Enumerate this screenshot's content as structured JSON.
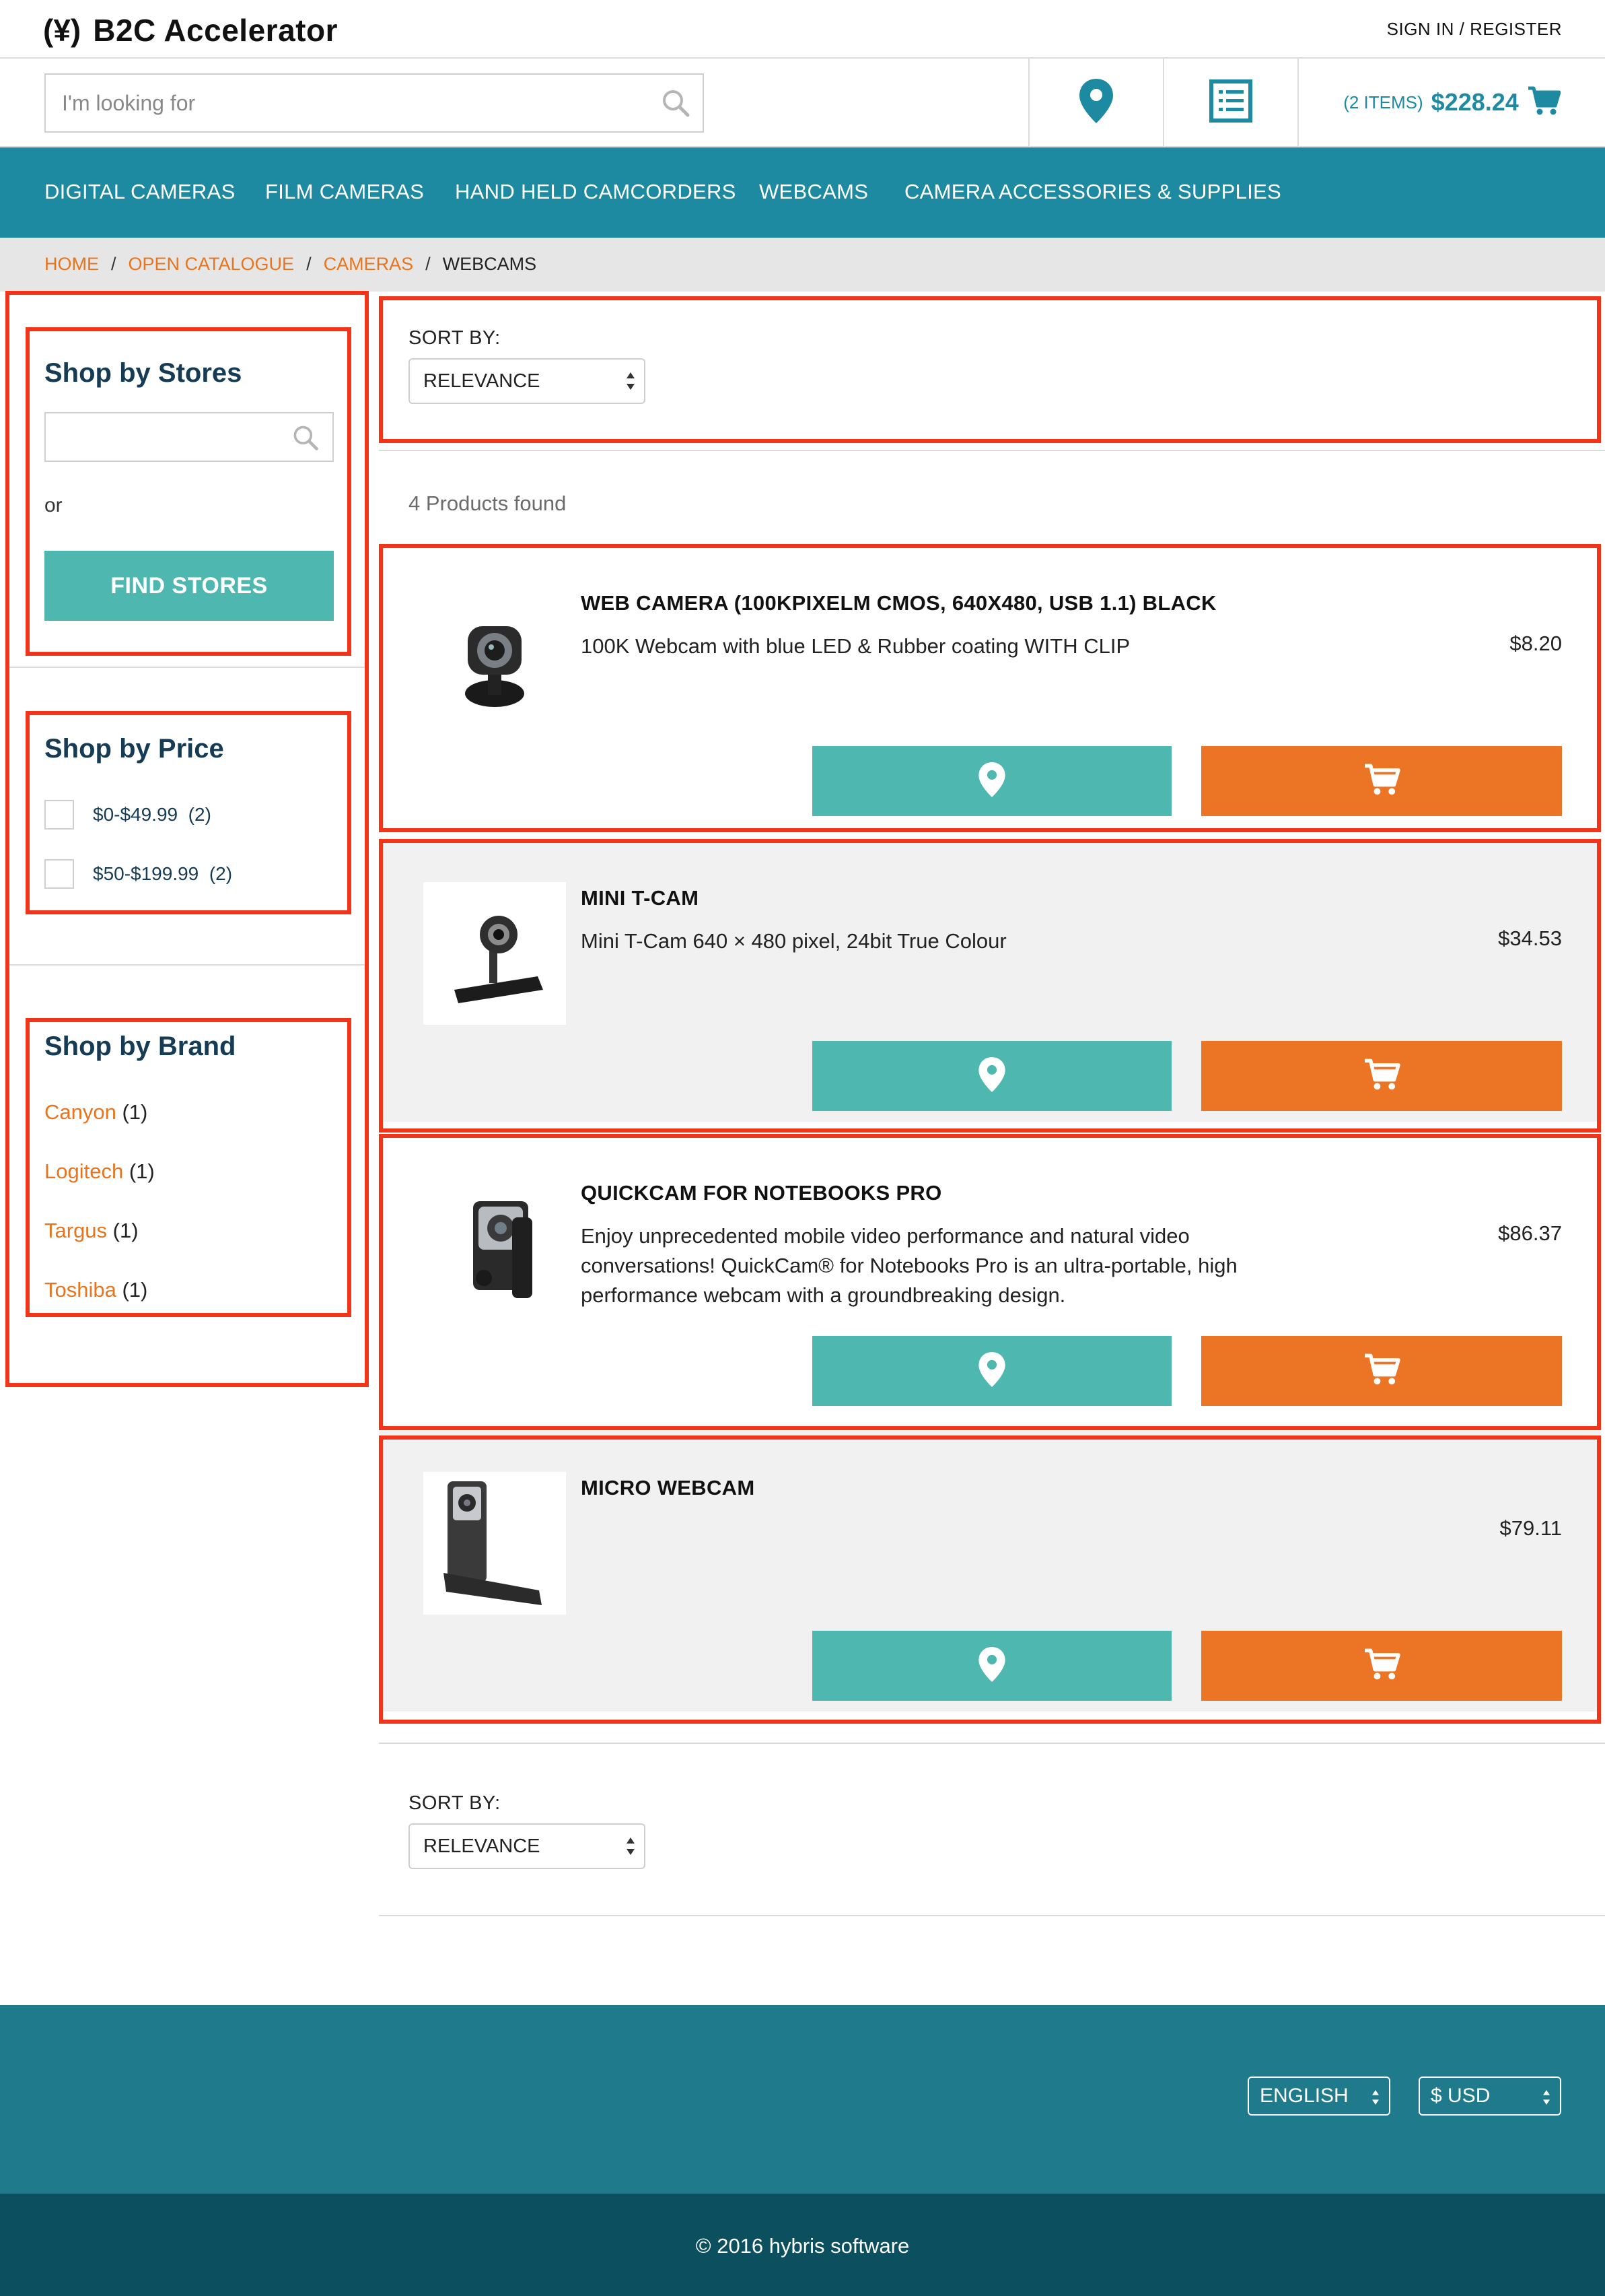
{
  "header": {
    "logo_mark": "(¥)",
    "brand": "B2C Accelerator",
    "signin": "SIGN IN / REGISTER"
  },
  "search": {
    "placeholder": "I'm looking for",
    "icon": "search-icon"
  },
  "header_icons": {
    "store_locator": "map-pin-icon",
    "quick_order": "list-icon",
    "cart": "cart-icon"
  },
  "cart": {
    "count_label": "(2 ITEMS)",
    "total": "$228.24"
  },
  "nav": {
    "items": [
      "DIGITAL CAMERAS",
      "FILM CAMERAS",
      "HAND HELD CAMCORDERS",
      "WEBCAMS",
      "CAMERA ACCESSORIES & SUPPLIES"
    ]
  },
  "breadcrumb": {
    "items": [
      "HOME",
      "OPEN CATALOGUE",
      "CAMERAS"
    ],
    "separator": "/",
    "current": "WEBCAMS"
  },
  "sidebar": {
    "stores": {
      "title": "Shop by Stores",
      "or": "or",
      "find_button": "FIND STORES"
    },
    "price": {
      "title": "Shop by Price",
      "options": [
        {
          "label": "$0-$49.99",
          "count": "(2)"
        },
        {
          "label": "$50-$199.99",
          "count": "(2)"
        }
      ]
    },
    "brand": {
      "title": "Shop by Brand",
      "options": [
        {
          "name": "Canyon",
          "count": "(1)"
        },
        {
          "name": "Logitech",
          "count": "(1)"
        },
        {
          "name": "Targus",
          "count": "(1)"
        },
        {
          "name": "Toshiba",
          "count": "(1)"
        }
      ]
    }
  },
  "sort": {
    "label": "SORT BY:",
    "value": "RELEVANCE"
  },
  "results": {
    "count_text": "4 Products found"
  },
  "products": [
    {
      "name": "WEB CAMERA (100KPIXELM CMOS, 640X480, USB 1.1) BLACK",
      "description": "100K Webcam with blue LED & Rubber coating WITH CLIP",
      "price": "$8.20"
    },
    {
      "name": "MINI T-CAM",
      "description": "Mini T-Cam 640 × 480 pixel, 24bit True Colour",
      "price": "$34.53"
    },
    {
      "name": "QUICKCAM FOR NOTEBOOKS PRO",
      "description": "Enjoy unprecedented mobile video performance and natural video conversations! QuickCam® for Notebooks Pro is an ultra-portable, high performance webcam with a groundbreaking design.",
      "price": "$86.37"
    },
    {
      "name": "MICRO WEBCAM",
      "description": "",
      "price": "$79.11"
    }
  ],
  "footer": {
    "language": "ENGLISH",
    "currency": "$ USD",
    "copyright": "© 2016 hybris software"
  },
  "colors": {
    "teal_nav": "#1d8aa1",
    "teal_button": "#4eb8b0",
    "orange_button": "#ec7425",
    "orange_link": "#e8741e",
    "footer": "#1f7a8c",
    "footer_dark": "#0c4f5f",
    "annotation": "#f23518"
  }
}
